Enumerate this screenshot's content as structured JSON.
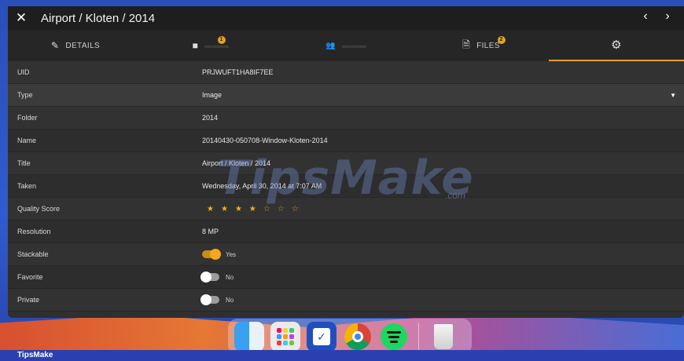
{
  "window": {
    "title": "Airport / Kloten / 2014",
    "close_glyph": "✕",
    "prev_glyph": "‹",
    "next_glyph": "›"
  },
  "tabs": [
    {
      "label": "DETAILS",
      "icon": "pencil-icon",
      "glyph": "✎",
      "badge": ""
    },
    {
      "label": "",
      "icon": "label-icon",
      "glyph": "■",
      "badge": "1"
    },
    {
      "label": "",
      "icon": "people-icon",
      "glyph": "👥",
      "badge": ""
    },
    {
      "label": "FILES",
      "icon": "file-icon",
      "glyph": "🗎",
      "badge": "2"
    },
    {
      "label": "",
      "icon": "gear-icon",
      "glyph": "⚙",
      "badge": ""
    }
  ],
  "active_tab": 4,
  "fields": {
    "uid": {
      "label": "UID",
      "value": "PRJWUFT1HA8IF7EE"
    },
    "type": {
      "label": "Type",
      "value": "Image",
      "dropdown_glyph": "▼"
    },
    "folder": {
      "label": "Folder",
      "value": "2014"
    },
    "name": {
      "label": "Name",
      "value": "20140430-050708-Window-Kloten-2014"
    },
    "title": {
      "label": "Title",
      "value": "Airport / Kloten / 2014"
    },
    "taken": {
      "label": "Taken",
      "value": "Wednesday, April 30, 2014 at 7:07 AM"
    },
    "quality": {
      "label": "Quality Score",
      "rating": 4,
      "max": 7,
      "filled_glyph": "★",
      "empty_glyph": "☆"
    },
    "resolution": {
      "label": "Resolution",
      "value": "8 MP"
    },
    "stackable": {
      "label": "Stackable",
      "on": true,
      "value": "Yes"
    },
    "favorite": {
      "label": "Favorite",
      "on": false,
      "value": "No"
    },
    "private": {
      "label": "Private",
      "on": false,
      "value": "No"
    }
  },
  "watermark": {
    "text": "TipsMake",
    "suffix": ".com"
  },
  "taskbar": {
    "label": "TipsMake"
  },
  "colors": {
    "accent": "#e5a122",
    "window_bg": "#2f2f2f",
    "titlebar_bg": "#1e1e1e",
    "desktop": "#2f5bd0"
  }
}
